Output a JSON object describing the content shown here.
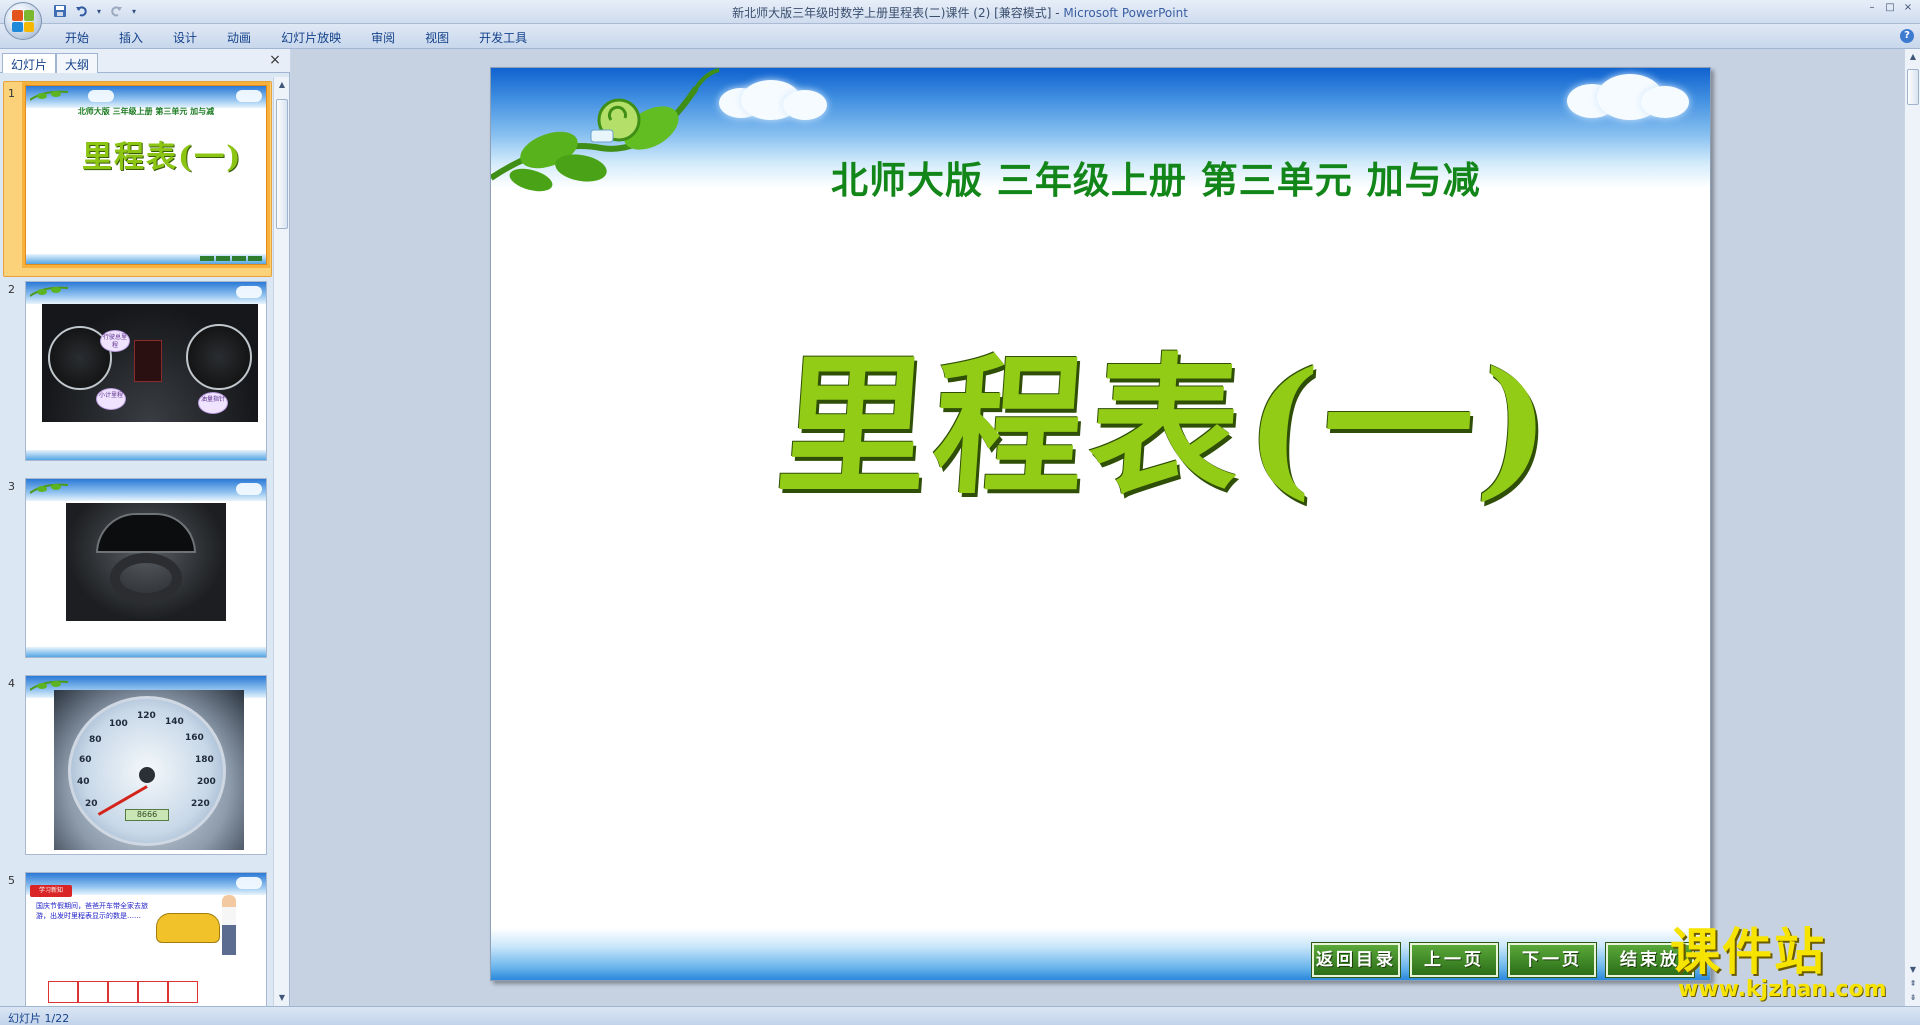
{
  "window": {
    "title": "新北师大版三年级时数学上册里程表(二)课件 (2) [兼容模式]",
    "title_separator": " - ",
    "app_name": "Microsoft PowerPoint",
    "controls": [
      "–",
      "□",
      "×"
    ]
  },
  "quick_access": {
    "save_icon": "save-icon",
    "undo_icon": "undo-icon",
    "redo_icon": "redo-icon",
    "customize_icon": "dropdown-icon"
  },
  "ribbon": {
    "tabs": [
      "开始",
      "插入",
      "设计",
      "动画",
      "幻灯片放映",
      "审阅",
      "视图",
      "开发工具"
    ],
    "help": "?"
  },
  "left_panel": {
    "tabs": [
      "幻灯片",
      "大纲"
    ],
    "close": "×",
    "thumbnails": [
      {
        "number": "1",
        "subtitle": "北师大版  三年级上册  第三单元  加与减",
        "title": "里程表(一)"
      },
      {
        "number": "2",
        "labels": [
          "行驶总里程",
          "小计里程",
          "油量指针"
        ]
      },
      {
        "number": "3"
      },
      {
        "number": "4",
        "speed_marks": [
          "20",
          "40",
          "60",
          "80",
          "100",
          "120",
          "140",
          "160",
          "180",
          "200",
          "220"
        ],
        "odometer": "8666"
      },
      {
        "number": "5",
        "header": "学习新知",
        "text": "国庆节假期间，爸爸开车带全家去旅游，出发时里程表显示的数是……"
      }
    ]
  },
  "slide": {
    "subtitle": "北师大版  三年级上册  第三单元  加与减",
    "title": "里程表(一)",
    "nav_buttons": [
      "返回目录",
      "上一页",
      "下一页",
      "结束放"
    ]
  },
  "watermark": {
    "main": "课件站",
    "url": "www.kjzhan.com"
  },
  "status": {
    "slide_indicator": "幻灯片 1/22"
  },
  "colors": {
    "ribbon_text": "#15428b",
    "title_green": "#93cc16",
    "subtitle_green": "#13861a",
    "selection_orange": "#f7b13d",
    "watermark_yellow": "#f6e400"
  }
}
